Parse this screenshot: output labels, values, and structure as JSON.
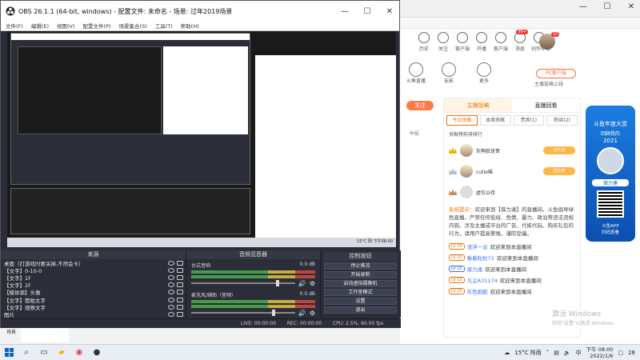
{
  "obs": {
    "title": "OBS 26.1.1 (64-bit, windows) - 配置文件: 未命名 - 场景: 过年2019场景",
    "win_buttons": [
      "—",
      "☐",
      "✕"
    ],
    "menu": [
      "文件(F)",
      "编辑(E)",
      "视图(V)",
      "配置文件(P)",
      "场景集合(S)",
      "工具(T)",
      "帮助(H)"
    ],
    "docks": {
      "sources_title": "来源",
      "mixer_title": "音频混音器",
      "controls_title": "控制按钮"
    },
    "sources": [
      "桌面（打游戏时要关掉,不然会卡）",
      "【文字】0-10-0",
      "【文字】1F",
      "【文字】2F",
      "【媒体源】头像",
      "【文字】赞助文字",
      "【文字】观察文字",
      "图片"
    ],
    "mixer": [
      {
        "name": "台式音响",
        "db": "0.0 dB",
        "level": 0.82
      },
      {
        "name": "麦克风/辅助（音频）",
        "db": "0.0 dB",
        "level": 0.78
      }
    ],
    "controls": [
      "停止推流",
      "开始录制",
      "启动虚拟摄像机",
      "工作室模式",
      "设置",
      "退出"
    ],
    "status": {
      "live": "LIVE: 00:00:00",
      "rec": "REC: 00:00:00",
      "cpu": "CPU: 2.5%, 60.00 fps"
    },
    "scene_label": "场景"
  },
  "browser": {
    "win_buttons": [
      "—",
      "☐",
      "✕"
    ],
    "nav": [
      {
        "label": "历史",
        "badge": ""
      },
      {
        "label": "关注",
        "badge": ""
      },
      {
        "label": "客户端",
        "badge": ""
      },
      {
        "label": "开播",
        "badge": ""
      },
      {
        "label": "客户端",
        "badge": ""
      },
      {
        "label": "消息",
        "badge": "99+"
      },
      {
        "label": "创作中心",
        "badge": ""
      }
    ],
    "avatar_badge": "15",
    "row2": [
      {
        "label": "斗鱼直播"
      },
      {
        "label": "友影"
      },
      {
        "label": "更多"
      }
    ],
    "pc_client": "PC客户端",
    "anchor_upload": "主播投稿上线",
    "follow": "关注",
    "report": "举报"
  },
  "rank": {
    "top_tabs": [
      "主播投稿",
      "直播回看"
    ],
    "sub_tabs": [
      "今日贡献",
      "本周贡献",
      "贵宾(1)",
      "粉丝(2)"
    ],
    "title": "贡献榜前排排行",
    "rows": [
      {
        "name": "灰鸭航班哥",
        "gift": "送礼物"
      },
      {
        "name": "cutie喵",
        "gift": "送礼物"
      },
      {
        "name": "虚位以待",
        "gift": ""
      }
    ],
    "notice_tag": "系统提示：",
    "notice": "欢迎来到【保力達】的直播间。斗鱼倡导绿色直播，严禁任何低俗、色情、暴力、政治等违法违规内容。涉及主播或平台的广告、代练代玩、购买礼包的行为，请用户提高警惕，谨防受骗。",
    "chat": [
      {
        "lv": "LV 19",
        "name": "流浮一派",
        "text": "欢迎来到本直播间",
        "blue": false
      },
      {
        "lv": "LV 10",
        "name": "乘着粒粒71",
        "text": "欢迎来到本直播间",
        "blue": false
      },
      {
        "lv": "LV 15",
        "name": "保力達",
        "text": "欢迎来到本直播间",
        "blue": true
      },
      {
        "lv": "LV 13",
        "name": "凡尘A31174",
        "text": "欢迎来到本直播间",
        "blue": false
      },
      {
        "lv": "LV 25",
        "name": "灰色跑酷",
        "text": "欢迎来到本直播间",
        "blue": false
      }
    ]
  },
  "ad": {
    "line1": "斗鱼年度大赏",
    "line2": "回顾我的",
    "year": "2021",
    "name": "保力達",
    "qr_caption1": "斗鱼APP",
    "qr_caption2": "扫码查看"
  },
  "watermark": [
    "激活 Windows",
    "转到\"设置\"以激活 Windows。"
  ],
  "taskbar": {
    "weather": "15°C 阵雨",
    "time": "下午 08:00",
    "date": "2022/1/6",
    "lang": "中",
    "notif": "28"
  },
  "preview_taskbar_meta": "15°C 阴 下午08:00",
  "colors": {
    "obs_bg": "#2b2e38",
    "accent_orange": "#f07000",
    "link_blue": "#3d72ff",
    "ad_blue": "#1a7de0"
  }
}
